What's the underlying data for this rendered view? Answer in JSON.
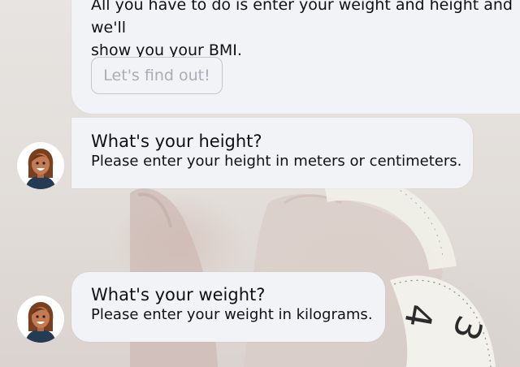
{
  "intro": {
    "line1": "All you have to do is enter your weight and height and we'll",
    "line2": "show you your BMI.",
    "button_label": "Let's find out!"
  },
  "messages": [
    {
      "title": "What's your height?",
      "subtitle": "Please enter your height in meters or centimeters."
    },
    {
      "title": "What's your weight?",
      "subtitle": "Please enter your weight in kilograms."
    }
  ],
  "tape_digits": [
    "3",
    "4"
  ]
}
